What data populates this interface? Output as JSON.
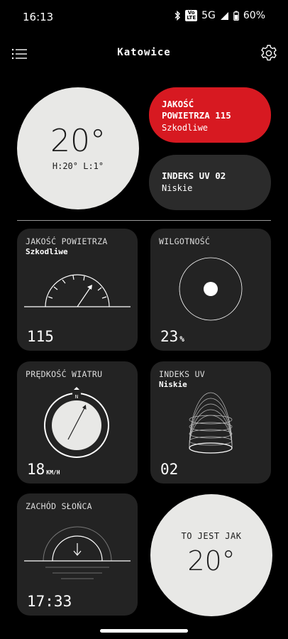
{
  "status_bar": {
    "time": "16:13",
    "volte_line1": "Vo",
    "volte_line2": "LTE",
    "network": "5G",
    "battery": "60%",
    "icons": [
      "bluetooth-icon",
      "signal-icon",
      "battery-icon"
    ]
  },
  "header": {
    "title": "Katowice",
    "menu_icon": "menu-icon",
    "settings_icon": "gear-icon"
  },
  "current": {
    "temperature": "20°",
    "high_low": "H:20° L:1°"
  },
  "air_quality_pill": {
    "title_line1": "JAKOŚĆ",
    "title_line2": "POWIETRZA 115",
    "status": "Szkodliwe",
    "color": "#d71921"
  },
  "uv_pill": {
    "title": "INDEKS UV 02",
    "status": "Niskie"
  },
  "cards": {
    "air_quality": {
      "label": "JAKOŚĆ POWIETRZA",
      "sub": "Szkodliwe",
      "value": "115",
      "gauge_level": 0.58
    },
    "humidity": {
      "label": "WILGOTNOŚĆ",
      "value": "23",
      "unit": "%"
    },
    "wind": {
      "label": "PRĘDKOŚĆ WIATRU",
      "value": "18",
      "unit": "KM/H",
      "compass_north": "N"
    },
    "uv_index": {
      "label": "INDEKS UV",
      "sub": "Niskie",
      "value": "02"
    },
    "sunset": {
      "label": "ZACHÓD SŁOŃCA",
      "value": "17:33"
    }
  },
  "feels_like": {
    "label": "TO JEST JAK",
    "temperature": "20°"
  }
}
